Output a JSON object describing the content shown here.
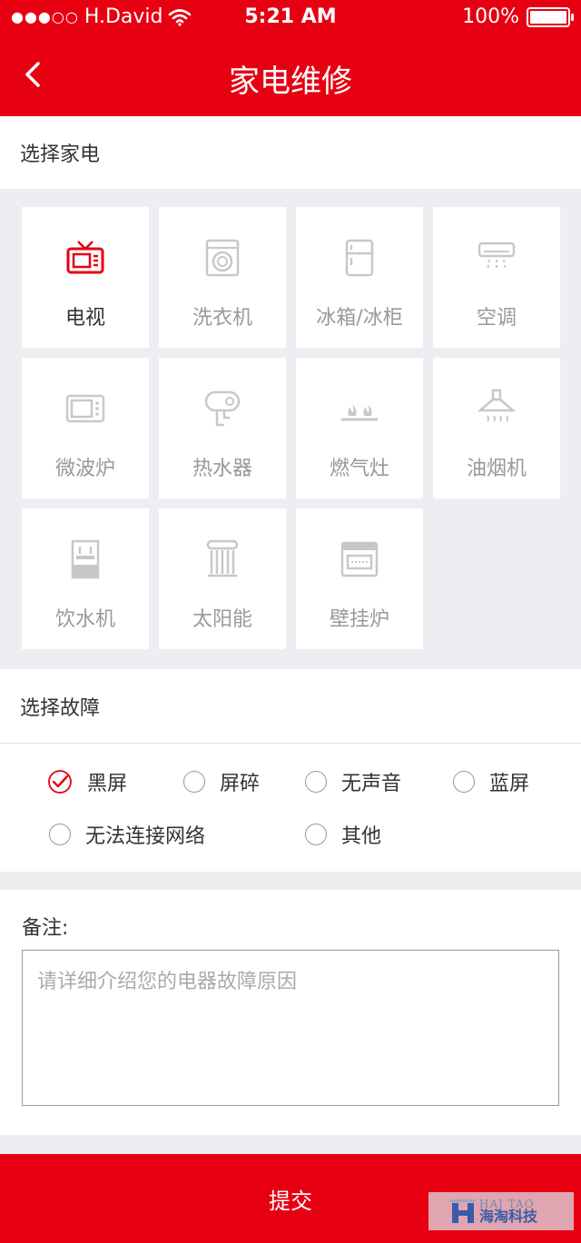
{
  "status": {
    "carrier": "H.David",
    "time": "5:21 AM",
    "battery": "100%"
  },
  "nav": {
    "title": "家电维修"
  },
  "appliance_section": {
    "title": "选择家电"
  },
  "appliances": [
    {
      "label": "电视",
      "icon": "tv-icon",
      "selected": true
    },
    {
      "label": "洗衣机",
      "icon": "washing-machine-icon",
      "selected": false
    },
    {
      "label": "冰箱/冰柜",
      "icon": "refrigerator-icon",
      "selected": false
    },
    {
      "label": "空调",
      "icon": "air-conditioner-icon",
      "selected": false
    },
    {
      "label": "微波炉",
      "icon": "microwave-icon",
      "selected": false
    },
    {
      "label": "热水器",
      "icon": "water-heater-icon",
      "selected": false
    },
    {
      "label": "燃气灶",
      "icon": "gas-stove-icon",
      "selected": false
    },
    {
      "label": "油烟机",
      "icon": "range-hood-icon",
      "selected": false
    },
    {
      "label": "饮水机",
      "icon": "water-dispenser-icon",
      "selected": false
    },
    {
      "label": "太阳能",
      "icon": "solar-heater-icon",
      "selected": false
    },
    {
      "label": "壁挂炉",
      "icon": "wall-boiler-icon",
      "selected": false
    }
  ],
  "fault_section": {
    "title": "选择故障"
  },
  "faults": [
    {
      "label": "黑屏",
      "checked": true
    },
    {
      "label": "屏碎",
      "checked": false
    },
    {
      "label": "无声音",
      "checked": false
    },
    {
      "label": "蓝屏",
      "checked": false
    },
    {
      "label": "无法连接网络",
      "checked": false
    },
    {
      "label": "其他",
      "checked": false
    }
  ],
  "remark": {
    "label": "备注:",
    "placeholder": "请详细介绍您的电器故障原因",
    "value": ""
  },
  "submit": {
    "label": "提交"
  },
  "watermark": {
    "en": "HAI TAO",
    "cn": "海淘科技"
  },
  "colors": {
    "primary": "#e60012",
    "background": "#eeeef2",
    "icon_inactive": "#c8c8c8"
  }
}
